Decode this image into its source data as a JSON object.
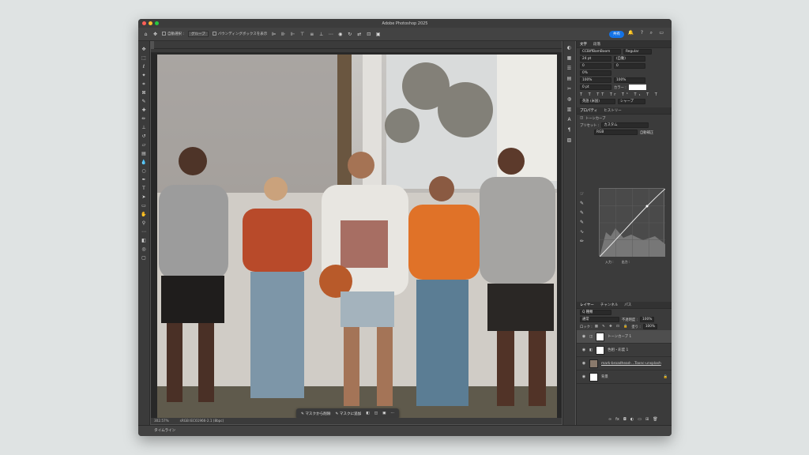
{
  "window": {
    "title": "Adobe Photoshop 2025"
  },
  "options": {
    "autoselect_label": "自動選択 :",
    "autoselect_value": "グループ",
    "transform_label": "バウンディングボックスを表示",
    "share_label": "共有"
  },
  "doctab": {
    "label": "名称未設定 1 @ 303% (トーンカーブ 1, レイヤーマスク/8) *"
  },
  "status": {
    "zoom": "302.57%",
    "profile": "sRGB IEC61966-2.1 (8bpc)"
  },
  "timeline": {
    "label": "タイムライン"
  },
  "ctx": {
    "mask_delete": "マスクから削除",
    "mask_add": "マスクに追加"
  },
  "character": {
    "tab1": "文字",
    "tab2": "段落",
    "font": "CCBiffBamBoom",
    "style": "Regular",
    "size": "24 pt",
    "leading": "(自動)",
    "kerning": "0",
    "tracking": "0",
    "vscale": "100%",
    "hscale": "100%",
    "baseline": "0 pt",
    "color_label": "カラー :",
    "lang": "英語 (米国)",
    "aa": "シャープ",
    "percent": "0%"
  },
  "properties": {
    "tab1": "プロパティ",
    "tab2": "ヒストリー",
    "adj_name": "トーンカーブ",
    "preset_label": "プリセット :",
    "preset_value": "カスタム",
    "channel": "RGB",
    "auto": "自動補正",
    "input_label": "入力 :",
    "output_label": "出力 :"
  },
  "layers": {
    "tab1": "レイヤー",
    "tab2": "チャンネル",
    "tab3": "パス",
    "filter": "Q 種類",
    "blend": "通常",
    "opacity_label": "不透明度 :",
    "opacity": "100%",
    "lock_label": "ロック :",
    "fill_label": "塗り :",
    "fill": "100%",
    "items": [
      {
        "name": "トーンカーブ 1"
      },
      {
        "name": "色相・彩度 1"
      },
      {
        "name": "mark-broadhead-...Toxnc-unsplash"
      },
      {
        "name": "背景"
      }
    ]
  },
  "colors": {
    "accent": "#1473e6",
    "bg": "#dfe3e3"
  }
}
